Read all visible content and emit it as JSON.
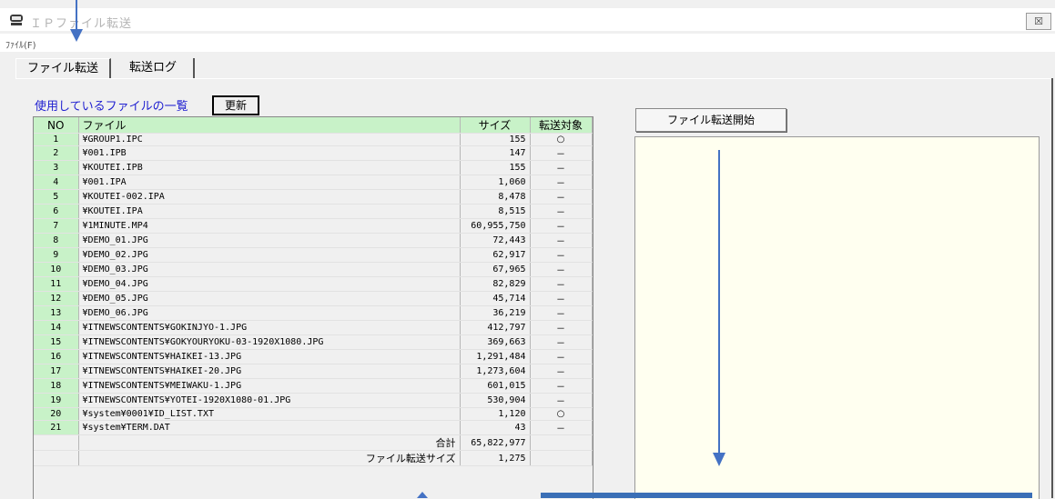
{
  "window": {
    "title": "ＩＰファイル転送",
    "close_label": "☒"
  },
  "menu": {
    "file_label": "ﾌｧｲﾙ(F)"
  },
  "tabs": [
    {
      "label": "ファイル転送",
      "active": true
    },
    {
      "label": "転送ログ",
      "active": false
    }
  ],
  "file_list": {
    "section_label": "使用しているファイルの一覧",
    "refresh_label": "更新",
    "columns": {
      "no": "NO",
      "file": "ファイル",
      "size": "サイズ",
      "target": "転送対象"
    },
    "rows": [
      {
        "no": "1",
        "file": "¥GROUP1.IPC",
        "size": "155",
        "target": "○"
      },
      {
        "no": "2",
        "file": "¥001.IPB",
        "size": "147",
        "target": "－"
      },
      {
        "no": "3",
        "file": "¥KOUTEI.IPB",
        "size": "155",
        "target": "－"
      },
      {
        "no": "4",
        "file": "¥001.IPA",
        "size": "1,060",
        "target": "－"
      },
      {
        "no": "5",
        "file": "¥KOUTEI-002.IPA",
        "size": "8,478",
        "target": "－"
      },
      {
        "no": "6",
        "file": "¥KOUTEI.IPA",
        "size": "8,515",
        "target": "－"
      },
      {
        "no": "7",
        "file": "¥1MINUTE.MP4",
        "size": "60,955,750",
        "target": "－"
      },
      {
        "no": "8",
        "file": "¥DEMO_01.JPG",
        "size": "72,443",
        "target": "－"
      },
      {
        "no": "9",
        "file": "¥DEMO_02.JPG",
        "size": "62,917",
        "target": "－"
      },
      {
        "no": "10",
        "file": "¥DEMO_03.JPG",
        "size": "67,965",
        "target": "－"
      },
      {
        "no": "11",
        "file": "¥DEMO_04.JPG",
        "size": "82,829",
        "target": "－"
      },
      {
        "no": "12",
        "file": "¥DEMO_05.JPG",
        "size": "45,714",
        "target": "－"
      },
      {
        "no": "13",
        "file": "¥DEMO_06.JPG",
        "size": "36,219",
        "target": "－"
      },
      {
        "no": "14",
        "file": "¥ITNEWSCONTENTS¥GOKINJYO-1.JPG",
        "size": "412,797",
        "target": "－"
      },
      {
        "no": "15",
        "file": "¥ITNEWSCONTENTS¥GOKYOURYOKU-03-1920X1080.JPG",
        "size": "369,663",
        "target": "－"
      },
      {
        "no": "16",
        "file": "¥ITNEWSCONTENTS¥HAIKEI-13.JPG",
        "size": "1,291,484",
        "target": "－"
      },
      {
        "no": "17",
        "file": "¥ITNEWSCONTENTS¥HAIKEI-20.JPG",
        "size": "1,273,604",
        "target": "－"
      },
      {
        "no": "18",
        "file": "¥ITNEWSCONTENTS¥MEIWAKU-1.JPG",
        "size": "601,015",
        "target": "－"
      },
      {
        "no": "19",
        "file": "¥ITNEWSCONTENTS¥YOTEI-1920X1080-01.JPG",
        "size": "530,904",
        "target": "－"
      },
      {
        "no": "20",
        "file": "¥system¥0001¥ID_LIST.TXT",
        "size": "1,120",
        "target": "○"
      },
      {
        "no": "21",
        "file": "¥system¥TERM.DAT",
        "size": "43",
        "target": "－"
      }
    ],
    "total_label": "合計",
    "total_value": "65,822,977",
    "transfer_size_label": "ファイル転送サイズ",
    "transfer_size_value": "1,275"
  },
  "transfer": {
    "start_label": "ファイル転送開始"
  },
  "colors": {
    "header_green": "#c8f2c8",
    "link_blue": "#1f1fd0",
    "log_bg": "#fffff0",
    "annotation_blue": "#4472c4"
  },
  "icons": {
    "app_icon": "monitor-icon",
    "close_icon": "close-icon"
  }
}
